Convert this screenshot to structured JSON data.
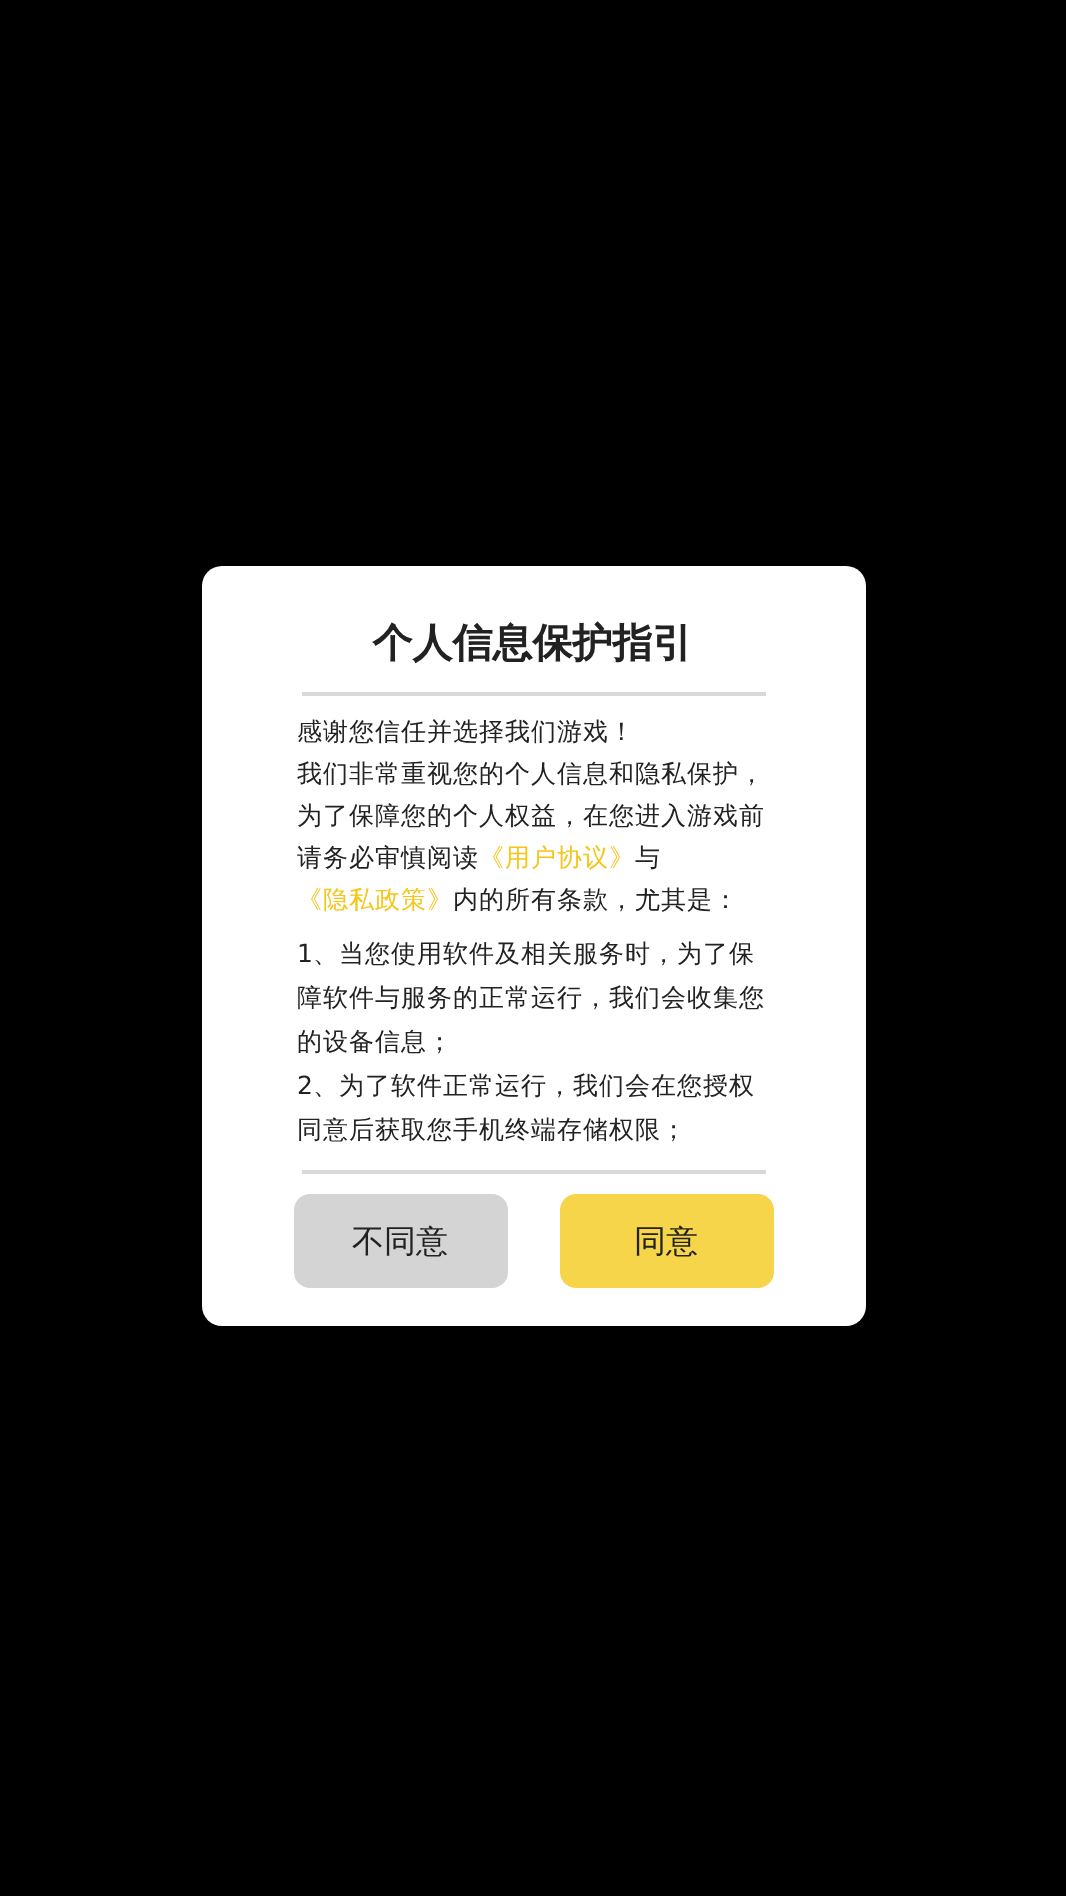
{
  "dialog": {
    "title": "个人信息保护指引",
    "greeting": "感谢您信任并选择我们游戏！",
    "notice": [
      {
        "kind": "text",
        "text": "我们非常重视您的个人信息和隐私保护，为了保障您的个人权益，在您进入游戏前请务必审慎阅读"
      },
      {
        "kind": "link",
        "text": "《用户协议》"
      },
      {
        "kind": "text",
        "text": "与"
      },
      {
        "kind": "link",
        "text": "《隐私政策》"
      },
      {
        "kind": "text",
        "text": "内的所有条款，尤其是："
      }
    ],
    "terms": [
      "1、当您使用软件及相关服务时，为了保障软件与服务的正常运行，我们会收集您的设备信息；",
      "2、为了软件正常运行，我们会在您授权同意后获取您手机终端存储权限；"
    ],
    "buttons": [
      {
        "kind": "decline",
        "label": "不同意"
      },
      {
        "kind": "accept",
        "label": "同意"
      }
    ]
  }
}
